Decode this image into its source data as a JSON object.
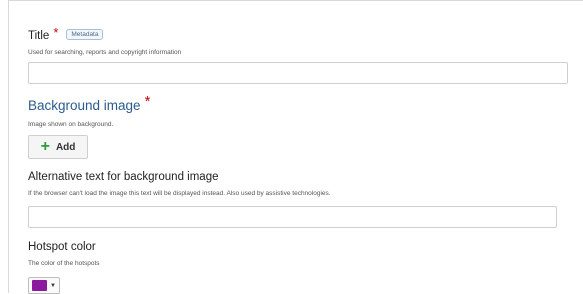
{
  "title_field": {
    "label": "Title",
    "required_mark": "*",
    "badge": "Metadata",
    "description": "Used for searching, reports and copyright information",
    "value": ""
  },
  "background_field": {
    "label": "Background image",
    "required_mark": "*",
    "description": "Image shown on background.",
    "add_label": "Add",
    "add_icon": "plus-icon"
  },
  "alt_field": {
    "label": "Alternative text for background image",
    "description": "If the browser can't load the image this text will be displayed instead. Also used by assistive technologies.",
    "value": ""
  },
  "hotspot_field": {
    "label": "Hotspot color",
    "description": "The color of the hotspots",
    "color": "#8b1a9e",
    "caret_icon": "caret-down-icon"
  },
  "colors": {
    "accent_label": "#2c5b8f",
    "required": "#cc0000",
    "add_icon": "#2f9a3a"
  }
}
